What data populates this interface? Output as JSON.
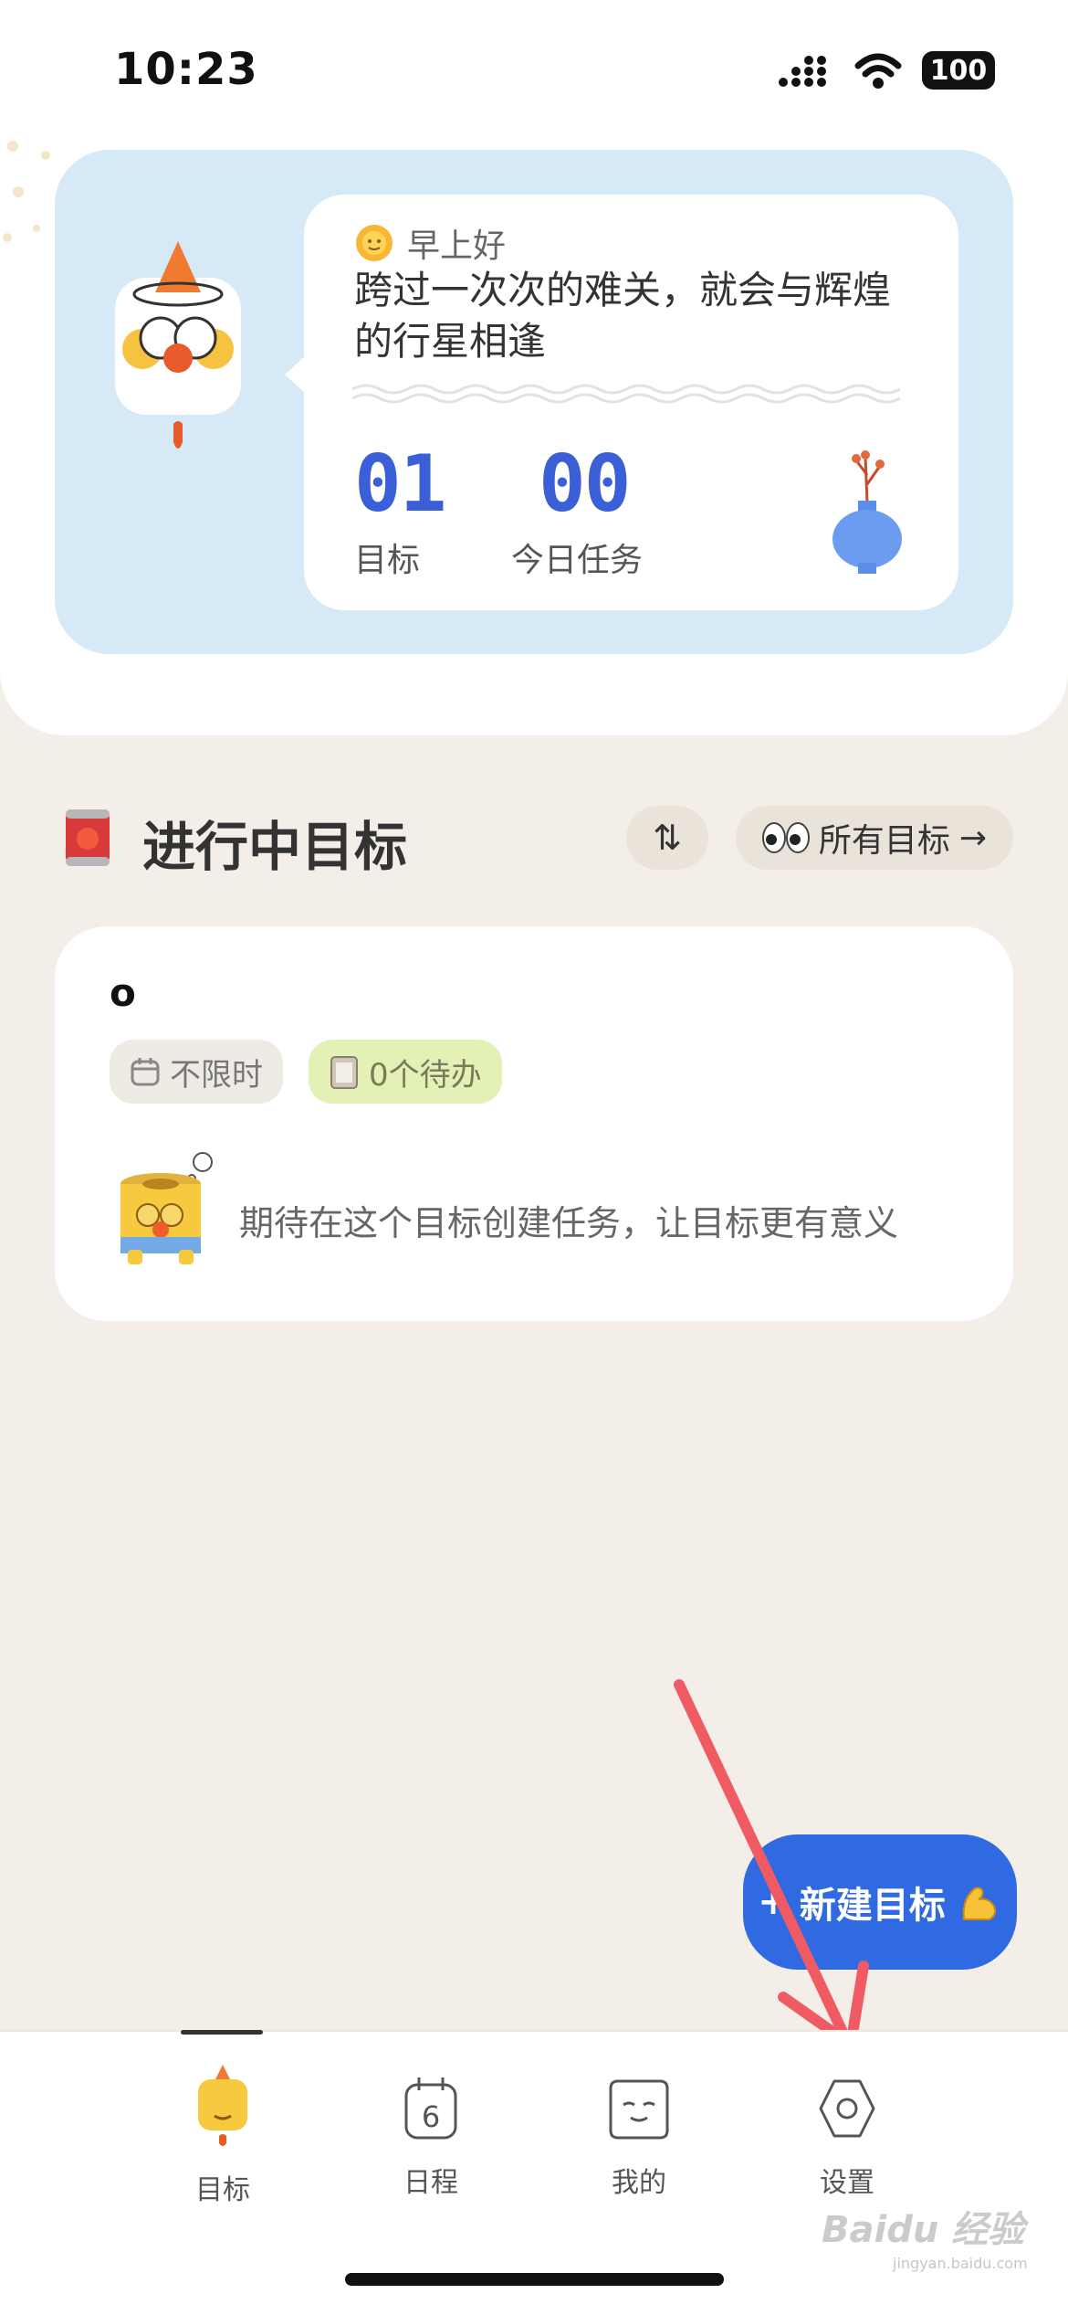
{
  "status_bar": {
    "time": "10:23",
    "battery": "100"
  },
  "banner": {
    "greeting": "早上好",
    "motto": "跨过一次次的难关，就会与辉煌的行星相逢",
    "stats": [
      {
        "value": "01",
        "label": "目标"
      },
      {
        "value": "00",
        "label": "今日任务"
      }
    ]
  },
  "section": {
    "title": "进行中目标",
    "all_goals_label": "所有目标",
    "sort_icon": "sort-icon"
  },
  "goal": {
    "title": "o",
    "time_chip": "不限时",
    "todo_chip": "0个待办",
    "empty_message": "期待在这个目标创建任务，让目标更有意义"
  },
  "fab": {
    "label": "新建目标"
  },
  "tabs": [
    {
      "label": "目标",
      "icon": "goal-mascot-icon",
      "active": true
    },
    {
      "label": "日程",
      "icon": "calendar-icon",
      "active": false
    },
    {
      "label": "我的",
      "icon": "profile-icon",
      "active": false
    },
    {
      "label": "设置",
      "icon": "settings-hexagon-icon",
      "active": false
    }
  ],
  "calendar_day": "6",
  "watermark": {
    "brand": "Baidu 经验",
    "url": "jingyan.baidu.com"
  },
  "colors": {
    "accent_blue": "#2f6ae3",
    "stat_blue": "#3b5fd6",
    "banner_bg": "#d5e9f6",
    "page_bg": "#f3efe8",
    "annotation_arrow": "#f05a62"
  }
}
